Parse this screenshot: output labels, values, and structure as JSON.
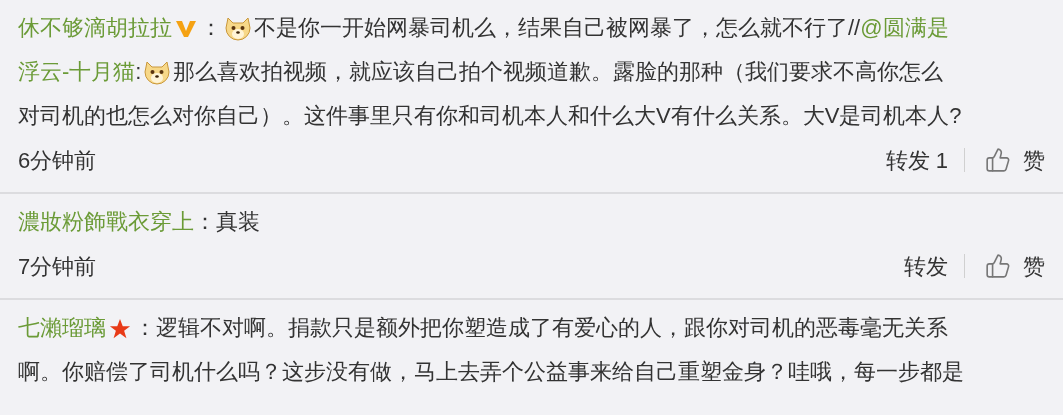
{
  "comments": [
    {
      "lines": [
        [
          {
            "kind": "user",
            "text": "休不够滴胡拉拉"
          },
          {
            "kind": "vbadge"
          },
          {
            "kind": "text",
            "text": "："
          },
          {
            "kind": "emoji"
          },
          {
            "kind": "text",
            "text": "不是你一开始网暴司机么，结果自己被网暴了，怎么就不行了//"
          },
          {
            "kind": "user",
            "text": "@圆满是"
          }
        ],
        [
          {
            "kind": "user",
            "text": "浮云-十月猫"
          },
          {
            "kind": "text",
            "text": ":"
          },
          {
            "kind": "emoji"
          },
          {
            "kind": "text",
            "text": "那么喜欢拍视频，就应该自己拍个视频道歉。露脸的那种（我们要求不高你怎么"
          }
        ],
        [
          {
            "kind": "text",
            "text": "对司机的也怎么对你自己）。这件事里只有你和司机本人和什么大V有什么关系。大V是司机本人?"
          }
        ]
      ],
      "time": "6分钟前",
      "repost": "转发 1",
      "like": "赞"
    },
    {
      "lines": [
        [
          {
            "kind": "user",
            "text": "濃妝粉飾戰衣穿上"
          },
          {
            "kind": "text",
            "text": "：真装"
          }
        ]
      ],
      "time": "7分钟前",
      "repost": "转发",
      "like": "赞"
    },
    {
      "lines": [
        [
          {
            "kind": "user",
            "text": "七瀨瑠璃"
          },
          {
            "kind": "star"
          },
          {
            "kind": "text",
            "text": "：逻辑不对啊。捐款只是额外把你塑造成了有爱心的人，跟你对司机的恶毒毫无关系"
          }
        ],
        [
          {
            "kind": "text",
            "text": "啊。你赔偿了司机什么吗？这步没有做，马上去弄个公益事来给自己重塑金身？哇哦，每一步都是"
          }
        ]
      ]
    }
  ]
}
